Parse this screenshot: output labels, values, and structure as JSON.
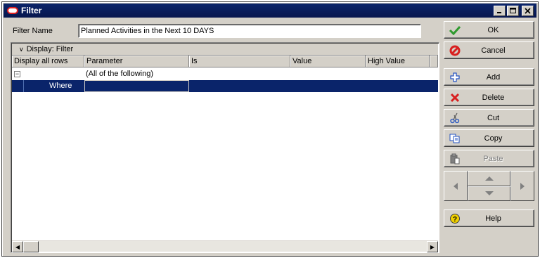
{
  "window": {
    "title": "Filter"
  },
  "filter_name": {
    "label": "Filter Name",
    "value": "Planned Activities in the Next 10 DAYS"
  },
  "display_bar": {
    "label": "Display: Filter"
  },
  "grid": {
    "columns": [
      "Display all rows",
      "Parameter",
      "Is",
      "Value",
      "High Value"
    ],
    "group_row": "(All of the following)",
    "where_row": "Where"
  },
  "buttons": {
    "ok": "OK",
    "cancel": "Cancel",
    "add": "Add",
    "delete": "Delete",
    "cut": "Cut",
    "copy": "Copy",
    "paste": "Paste",
    "help": "Help"
  },
  "icons": {
    "ok": "check-icon",
    "cancel": "no-entry-icon",
    "add": "plus-icon",
    "delete": "x-icon",
    "cut": "scissors-icon",
    "copy": "copy-icon",
    "paste": "paste-icon",
    "help": "question-icon"
  },
  "colors": {
    "titlebar": "#0a246a",
    "selection": "#0a246a",
    "ok_icon": "#2e9a2e",
    "cancel_icon": "#d82020",
    "delete_icon": "#d82020",
    "help_icon": "#e8c000"
  }
}
